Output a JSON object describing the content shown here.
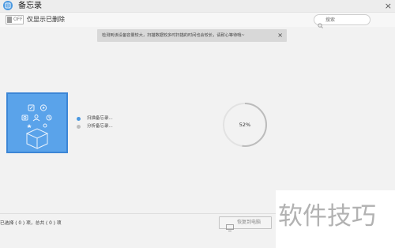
{
  "window": {
    "title": "备忘录",
    "close_glyph": "×",
    "icon": "memo-app-icon"
  },
  "toolbar": {
    "toggle_state_text": "OFF",
    "toggle_label": "仅显示已删除",
    "search_placeholder": "搜索"
  },
  "notice": {
    "text": "检测到该设备容量较大，扫描数据较多时扫描的时间也会较长，请耐心等待哦~",
    "close_glyph": "×"
  },
  "scan_status": {
    "items": [
      {
        "label": "扫描备忘录...",
        "color": "#4a98e0"
      },
      {
        "label": "分析备忘录...",
        "color": "#bdbdbd"
      }
    ]
  },
  "progress": {
    "percent_text": "52%",
    "value": 0.52,
    "ring_color": "#bcbcbc",
    "track_color": "#e2e2e2"
  },
  "footer": {
    "selection_text": "已选择 ( 0 ) 项，总共 ( 0 ) 项",
    "restore_button_label": "恢复到电脑"
  },
  "watermark": {
    "text": "软件技巧"
  },
  "colors": {
    "accent": "#4a98e0",
    "illustration_bg": "#5aa3ea",
    "illustration_border": "#3c86d6"
  }
}
